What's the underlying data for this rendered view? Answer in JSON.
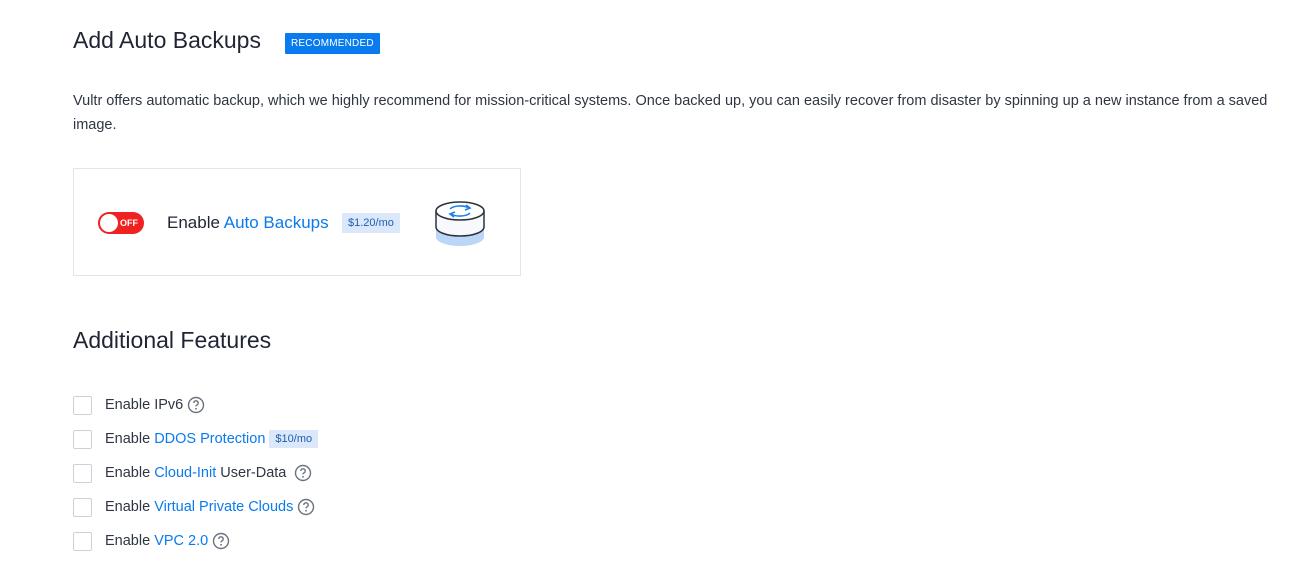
{
  "backups": {
    "title": "Add Auto Backups",
    "badge": "RECOMMENDED",
    "description": "Vultr offers automatic backup, which we highly recommend for mission-critical systems. Once backed up, you can easily recover from disaster by spinning up a new instance from a saved image.",
    "toggle_state": "OFF",
    "enable_prefix": "Enable",
    "enable_link": "Auto Backups",
    "price": "$1.20/mo",
    "illustration_icon": "backup-disk-icon"
  },
  "features": {
    "title": "Additional Features",
    "items": [
      {
        "prefix": "Enable",
        "link": "",
        "label": "IPv6",
        "price": "",
        "help_icon": "question-circle-icon",
        "checked": false
      },
      {
        "prefix": "Enable",
        "link": "DDOS Protection",
        "label": "",
        "price": "$10/mo",
        "help_icon": "",
        "checked": false
      },
      {
        "prefix": "Enable",
        "link": "Cloud-Init",
        "label": "User-Data",
        "price": "",
        "help_icon": "question-circle-icon",
        "checked": false
      },
      {
        "prefix": "Enable",
        "link": "Virtual Private Clouds",
        "label": "",
        "price": "",
        "help_icon": "question-circle-icon",
        "checked": false
      },
      {
        "prefix": "Enable",
        "link": "VPC 2.0",
        "label": "",
        "price": "",
        "help_icon": "question-circle-icon",
        "checked": false
      }
    ]
  },
  "colors": {
    "accent": "#0a7bee",
    "toggle_off": "#ef2121",
    "price_bg": "#dbe8fb"
  }
}
